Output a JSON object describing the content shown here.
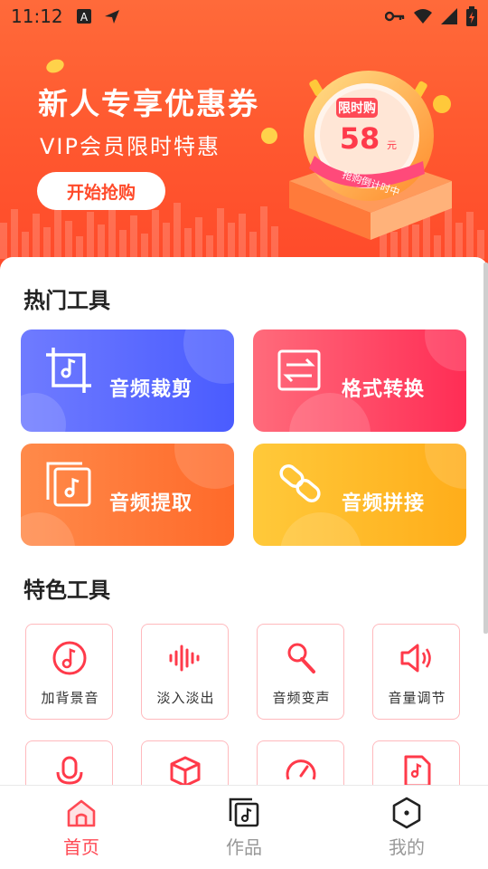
{
  "status_bar": {
    "time": "11:12"
  },
  "banner": {
    "title": "新人专享优惠券",
    "subtitle": "VIP会员限时特惠",
    "button_label": "开始抢购",
    "badge_title": "限时购",
    "badge_price": "58",
    "badge_unit": "元",
    "ribbon_text": "抢购倒计时中"
  },
  "hot_tools": {
    "title": "热门工具",
    "items": [
      {
        "label": "音频裁剪",
        "icon": "crop-icon"
      },
      {
        "label": "格式转换",
        "icon": "convert-icon"
      },
      {
        "label": "音频提取",
        "icon": "extract-icon"
      },
      {
        "label": "音频拼接",
        "icon": "link-icon"
      }
    ]
  },
  "feature_tools": {
    "title": "特色工具",
    "items": [
      {
        "label": "加背景音",
        "icon": "music-note-icon"
      },
      {
        "label": "淡入淡出",
        "icon": "waveform-icon"
      },
      {
        "label": "音频变声",
        "icon": "microphone-icon"
      },
      {
        "label": "音量调节",
        "icon": "speaker-icon"
      },
      {
        "label": "",
        "icon": "mic-icon"
      },
      {
        "label": "",
        "icon": "box-icon"
      },
      {
        "label": "",
        "icon": "speedometer-icon"
      },
      {
        "label": "",
        "icon": "text-file-icon"
      }
    ]
  },
  "bottom_nav": {
    "items": [
      {
        "label": "首页",
        "icon": "home-icon",
        "active": true
      },
      {
        "label": "作品",
        "icon": "works-icon",
        "active": false
      },
      {
        "label": "我的",
        "icon": "profile-icon",
        "active": false
      }
    ]
  },
  "colors": {
    "accent": "#ff4a55",
    "banner": "#ff5a30"
  }
}
